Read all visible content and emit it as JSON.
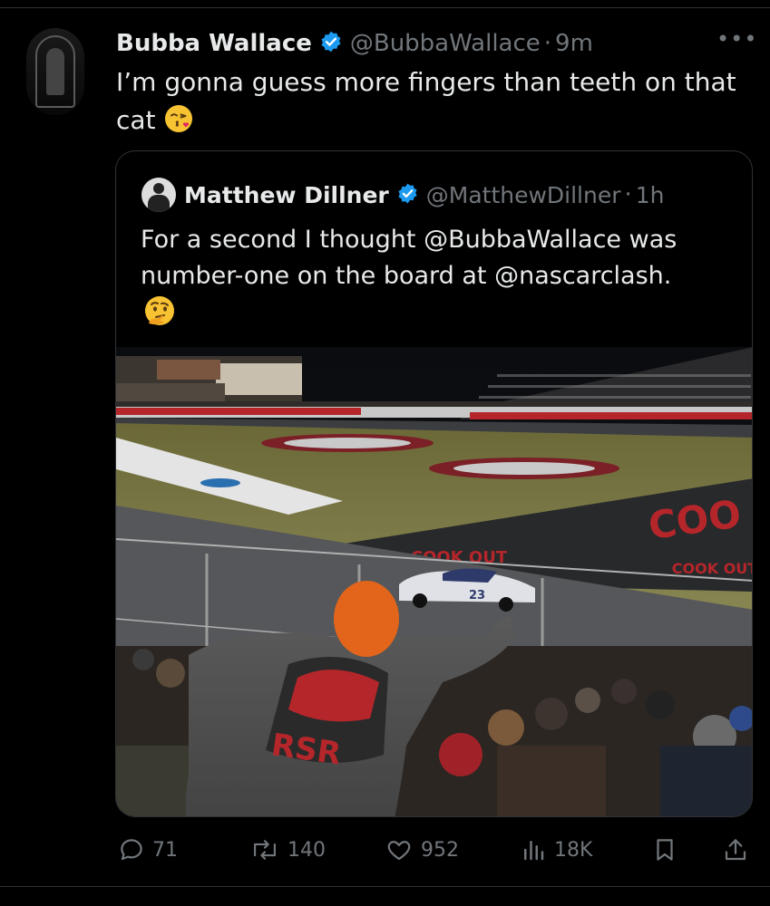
{
  "tweet": {
    "author_name": "Bubba Wallace",
    "author_handle": "@BubbaWallace",
    "separator": "·",
    "time": "9m",
    "text": "I’m gonna guess more fingers than teeth on that cat",
    "emoji": "face-blowing-a-kiss",
    "more_label": "•••"
  },
  "quoted": {
    "author_name": "Matthew Dillner",
    "author_handle": "@MatthewDillner",
    "separator": "·",
    "time": "1h",
    "text": "For a second I thought @BubbaWallace was number-one on the board at @nascarclash.",
    "emoji": "thinking-face",
    "photo_logos": [
      "COOK OUT",
      "COOK OUT",
      "COO"
    ],
    "photo_shirt_text": "RSR",
    "photo_car_number": "23"
  },
  "actions": {
    "replies": "71",
    "reposts": "140",
    "likes": "952",
    "views": "18K"
  },
  "colors": {
    "background": "#000000",
    "text": "#e7e9ea",
    "muted": "#71767b",
    "verified": "#1d9bf0",
    "border": "#2f3336"
  }
}
